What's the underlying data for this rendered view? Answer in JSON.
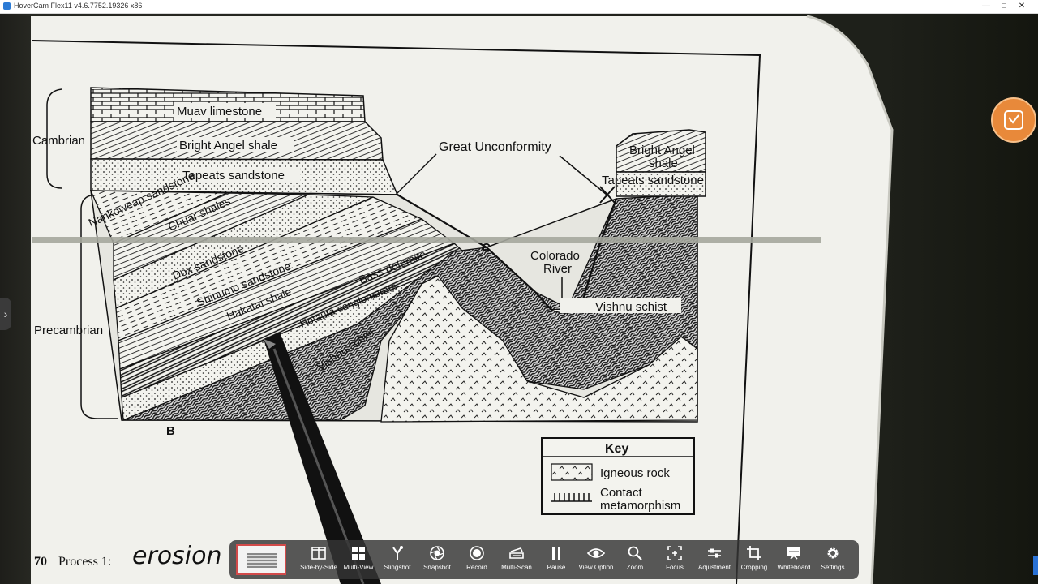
{
  "window": {
    "title": "HoverCam Flex11 v4.6.7752.19326 x86",
    "minimize": "—",
    "maximize": "□",
    "close": "✕"
  },
  "diagram": {
    "strata_top": [
      "Muav limestone",
      "Bright Angel shale",
      "Tapeats sandstone"
    ],
    "strata_tilted": [
      "Nankoweap sandstone",
      "Chuar shales",
      "Dox sandstone",
      "Shinumo sandstone",
      "Hakatai shale",
      "Bass dolomite",
      "Hotauta conglomerate",
      "Vishnu schist"
    ],
    "label_cambrian": "Cambrian",
    "label_precambrian": "Precambrian",
    "label_great_unconformity": "Great Unconformity",
    "label_right_bright_angel_1": "Bright Angel",
    "label_right_bright_angel_2": "shale",
    "label_right_tapeats": "Tapeats sandstone",
    "label_colorado_1": "Colorado",
    "label_colorado_2": "River",
    "label_vishnu_right": "Vishnu schist",
    "label_b": "B",
    "label_c": "C",
    "key_title": "Key",
    "key_igneous": "Igneous rock",
    "key_contact_1": "Contact",
    "key_contact_2": "metamorphism",
    "question_number": "70",
    "question_label": "Process 1:",
    "handwritten_answer": "erosion"
  },
  "toolbar": {
    "items": [
      {
        "name": "side-by-side",
        "label": "Side-by-Side"
      },
      {
        "name": "multi-view",
        "label": "Multi-View"
      },
      {
        "name": "slingshot",
        "label": "Slingshot"
      },
      {
        "name": "snapshot",
        "label": "Snapshot"
      },
      {
        "name": "record",
        "label": "Record"
      },
      {
        "name": "multi-scan",
        "label": "Multi-Scan"
      },
      {
        "name": "pause",
        "label": "Pause"
      },
      {
        "name": "view-option",
        "label": "View Option"
      },
      {
        "name": "zoom",
        "label": "Zoom"
      },
      {
        "name": "focus",
        "label": "Focus"
      },
      {
        "name": "adjustment",
        "label": "Adjustment"
      },
      {
        "name": "cropping",
        "label": "Cropping"
      },
      {
        "name": "whiteboard",
        "label": "Whiteboard"
      },
      {
        "name": "settings",
        "label": "Settings"
      }
    ]
  },
  "colors": {
    "accent": "#e8893a",
    "record": "#d24a4a"
  }
}
